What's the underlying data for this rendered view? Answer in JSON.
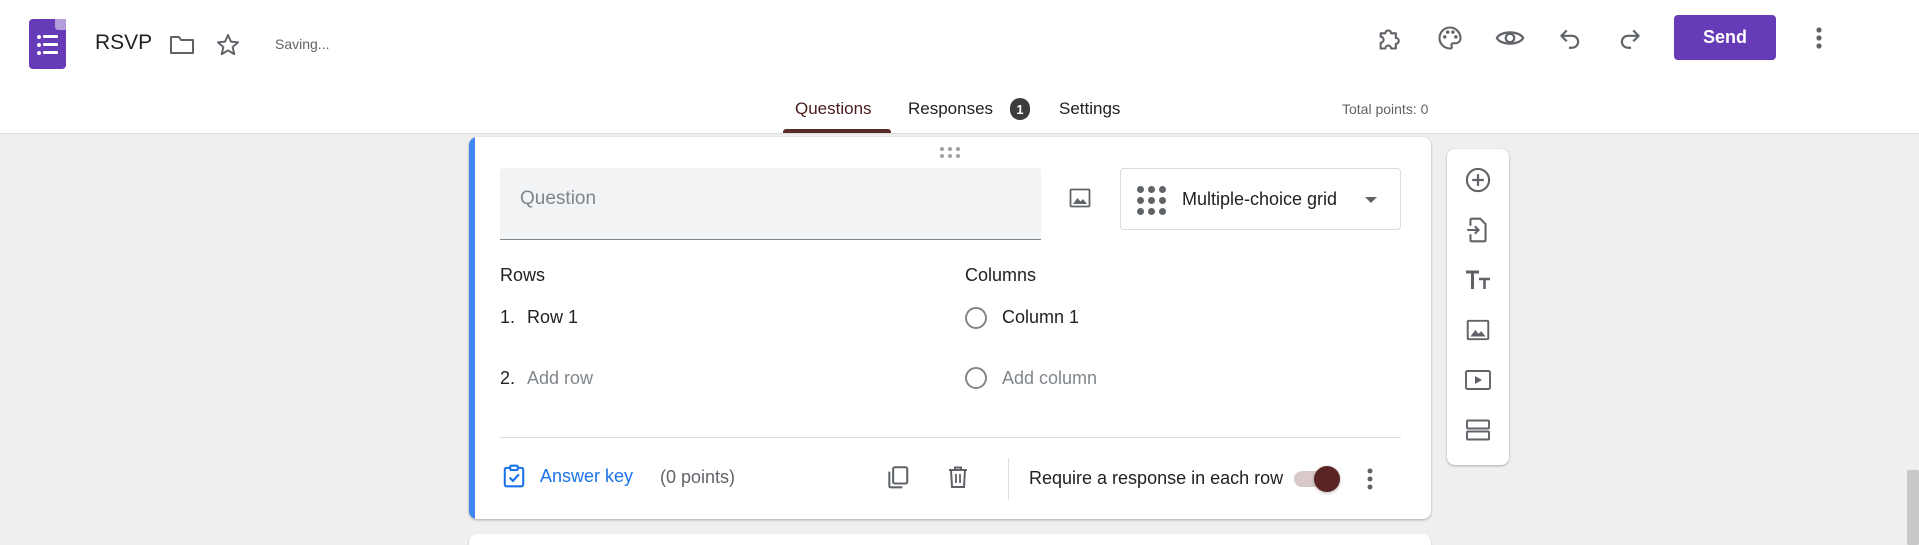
{
  "header": {
    "title": "RSVP",
    "status": "Saving...",
    "send_label": "Send",
    "icons": [
      "folder-icon",
      "star-icon",
      "puzzle-icon",
      "palette-icon",
      "preview-eye-icon",
      "undo-icon",
      "redo-icon",
      "more-vert-icon"
    ]
  },
  "tabs": [
    {
      "label": "Questions",
      "active": true
    },
    {
      "label": "Responses",
      "badge": "1"
    },
    {
      "label": "Settings"
    }
  ],
  "total_points": "Total points: 0",
  "question": {
    "placeholder": "Question",
    "type": "Multiple-choice grid",
    "rows_label": "Rows",
    "columns_label": "Columns",
    "rows": [
      {
        "num": "1.",
        "label": "Row 1"
      }
    ],
    "add_row": {
      "num": "2.",
      "label": "Add row"
    },
    "columns": [
      "Column 1"
    ],
    "add_column": "Add column",
    "answer_key": "Answer key",
    "points": "(0 points)",
    "require_label": "Require a response in each row",
    "require_on": true
  },
  "colors": {
    "brand": "#673ab7",
    "accent": "#4285f4",
    "toggle": "#5b2323",
    "link": "#1a73e8"
  }
}
